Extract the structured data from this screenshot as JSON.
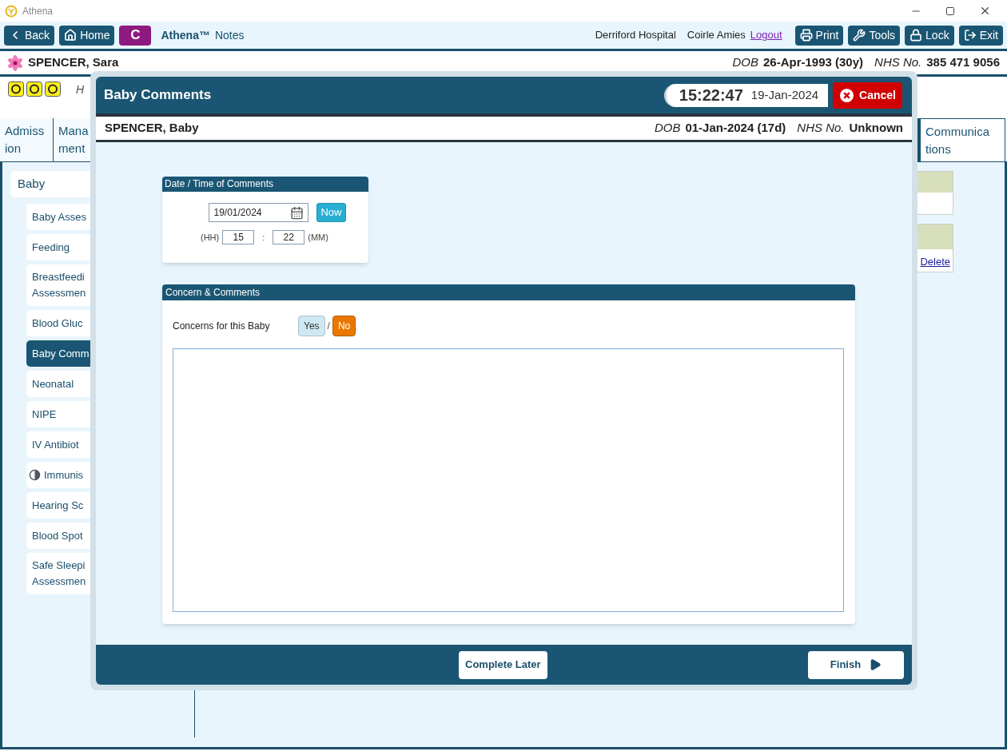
{
  "window": {
    "title": "Athena"
  },
  "toolbar": {
    "nav": [
      {
        "label": "Back",
        "kind": "back"
      },
      {
        "label": "Home",
        "kind": "home"
      },
      {
        "label": "C",
        "kind": "letter"
      }
    ],
    "app_name": "Athena™",
    "app_suffix": "Notes",
    "hospital": "Derriford Hospital",
    "user": "Coirle Amies",
    "logout": "Logout",
    "actions": [
      {
        "label": "Print",
        "kind": "print"
      },
      {
        "label": "Tools",
        "kind": "tools"
      },
      {
        "label": "Lock",
        "kind": "lock"
      },
      {
        "label": "Exit",
        "kind": "exit"
      }
    ]
  },
  "patient": {
    "name": "SPENCER, Sara",
    "dob_label": "DOB",
    "dob": "26-Apr-1993 (30y)",
    "nhs_label": "NHS No.",
    "nhs": "385 471 9056"
  },
  "alert_text": "H",
  "tabs": [
    {
      "lines": [
        "Admiss",
        "ion"
      ],
      "selected": false
    },
    {
      "lines": [
        "Mana",
        "ment"
      ],
      "selected": false
    },
    {
      "lines": [
        "Communica",
        "tions"
      ],
      "selected": true
    }
  ],
  "sidebar": {
    "section": "Baby",
    "items": [
      {
        "lines": [
          "Baby Asses"
        ],
        "selected": false,
        "kind": "plain"
      },
      {
        "lines": [
          "Feeding"
        ],
        "selected": false,
        "kind": "plain"
      },
      {
        "lines": [
          "Breastfeedi",
          "Assessmen"
        ],
        "selected": false,
        "kind": "plain"
      },
      {
        "lines": [
          "Blood Gluc"
        ],
        "selected": false,
        "kind": "plain"
      },
      {
        "lines": [
          "Baby Comm"
        ],
        "selected": true,
        "kind": "plain"
      },
      {
        "lines": [
          "Neonatal"
        ],
        "selected": false,
        "kind": "plain"
      },
      {
        "lines": [
          "NIPE"
        ],
        "selected": false,
        "kind": "plain"
      },
      {
        "lines": [
          "IV Antibiot"
        ],
        "selected": false,
        "kind": "plain"
      },
      {
        "lines": [
          "Immunis"
        ],
        "selected": false,
        "kind": "partial"
      },
      {
        "lines": [
          "Hearing Sc"
        ],
        "selected": false,
        "kind": "plain"
      },
      {
        "lines": [
          "Blood Spot"
        ],
        "selected": false,
        "kind": "plain"
      },
      {
        "lines": [
          "Safe Sleepi",
          "Assessmen"
        ],
        "selected": false,
        "kind": "plain"
      }
    ]
  },
  "right_panel": {
    "link": "Delete"
  },
  "modal": {
    "title": "Baby Comments",
    "time": "15:22:47",
    "date": "19-Jan-2024",
    "cancel": "Cancel",
    "baby": {
      "name": "SPENCER, Baby",
      "dob_label": "DOB",
      "dob": "01-Jan-2024 (17d)",
      "nhs_label": "NHS No.",
      "nhs": "Unknown"
    },
    "datetime_panel": {
      "title": "Date / Time of Comments",
      "date": "19/01/2024",
      "now": "Now",
      "hh_label": "(HH)",
      "hh": "15",
      "sep": ":",
      "mm": "22",
      "mm_label": "(MM)"
    },
    "concern_panel": {
      "title": "Concern & Comments",
      "question": "Concerns for this Baby",
      "options": [
        {
          "label": "Yes",
          "selected": false
        },
        {
          "label": "No",
          "selected": true
        }
      ],
      "divider": "/"
    },
    "footer": {
      "later": "Complete Later",
      "finish": "Finish"
    }
  }
}
